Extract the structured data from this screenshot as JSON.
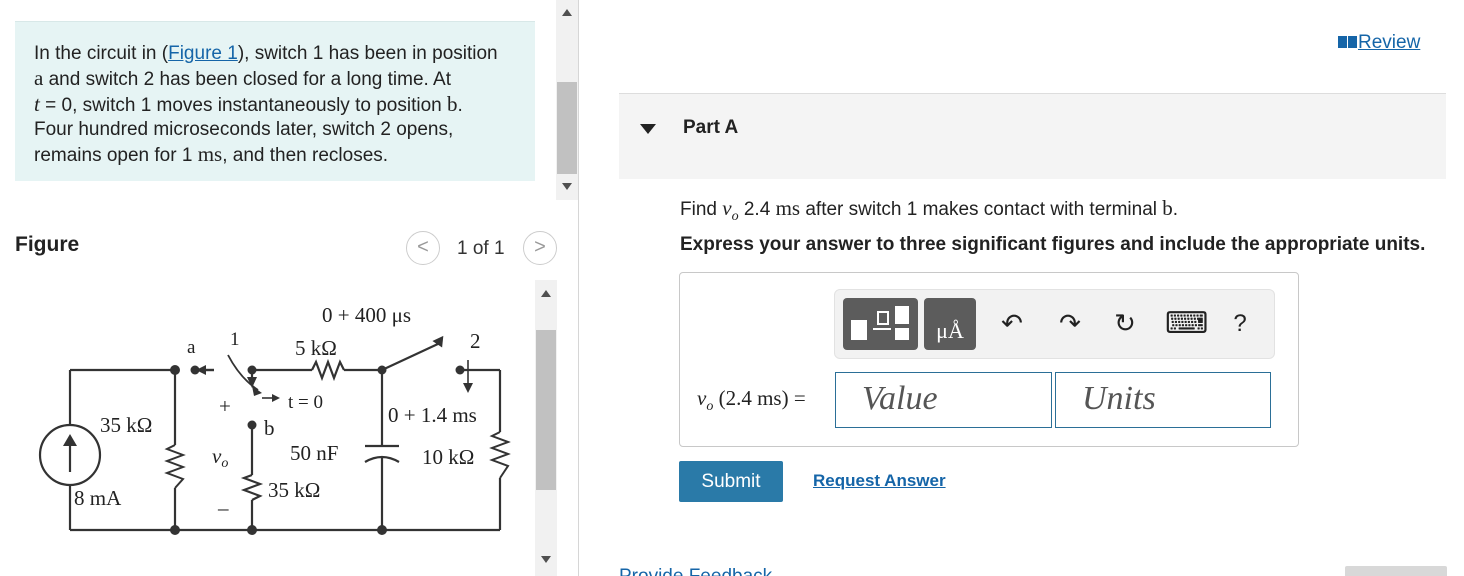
{
  "problem": {
    "t1": "In the circuit in (",
    "figure_link": "Figure 1",
    "t2": "), switch 1 has been in position",
    "pos_a": "a",
    "t3": " and switch 2 has been closed for a long time. At",
    "t_var": "t",
    "t4": " = 0, switch 1 moves instantaneously to position ",
    "pos_b": "b",
    "t5": ".",
    "t6": "Four hundred microseconds later, switch 2 opens,",
    "t7": "remains open for 1 ",
    "ms": "ms",
    "t8": ", and then recloses."
  },
  "figure": {
    "title": "Figure",
    "pager": "1 of 1",
    "prev": "<",
    "next": ">",
    "labels": {
      "time1": "0 + 400 μs",
      "r1": "5 kΩ",
      "node_a": "a",
      "sw1": "1",
      "sw2": "2",
      "t0": "t = 0",
      "time2": "0 + 1.4 ms",
      "r_src": "35 kΩ",
      "plus": "+",
      "node_b": "b",
      "vo": "v",
      "vo_sub": "o",
      "cap": "50 nF",
      "r2": "10 kΩ",
      "r3": "35 kΩ",
      "src": "8 mA",
      "minus": "–"
    }
  },
  "review": "Review",
  "part": {
    "title": "Part A",
    "q_find": "Find ",
    "q_v": "v",
    "q_sub": "o",
    "q_num": " 2.4 ",
    "q_ms": "ms",
    "q_rest": " after switch 1 makes contact with terminal ",
    "q_b": "b",
    "q_end": ".",
    "instruction": "Express your answer to three significant figures and include the appropriate units."
  },
  "answer": {
    "eq_v": "v",
    "eq_sub": "o",
    "eq_rest": " (2.4 ms) =",
    "value_placeholder": "Value",
    "units_placeholder": "Units"
  },
  "toolbar": {
    "units_glyph": "μÅ",
    "undo": "↶",
    "redo": "↷",
    "reset": "↻",
    "keyboard": "⌨",
    "help": "?"
  },
  "buttons": {
    "submit": "Submit",
    "request_answer": "Request Answer",
    "feedback": "Provide Feedback"
  }
}
